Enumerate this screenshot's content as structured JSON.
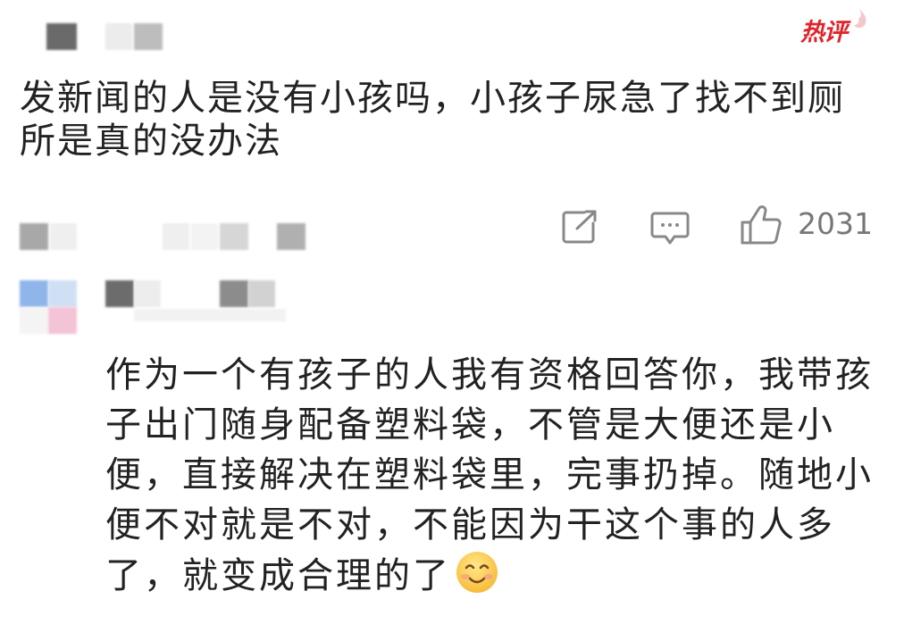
{
  "badges": {
    "hot": "热评"
  },
  "comment": {
    "text": "发新闻的人是没有小孩吗，小孩子尿急了找不到厕所是真的没办法",
    "like_count": "2031"
  },
  "reply": {
    "text": "作为一个有孩子的人我有资格回答你，我带孩子出门随身配备塑料袋，不管是大便还是小便，直接解决在塑料袋里，完事扔掉。随地小便不对就是不对，不能因为干这个事的人多了，就变成合理的了"
  },
  "icons": {
    "hot": "flame-icon",
    "share": "share-icon",
    "comment": "comment-icon",
    "like": "thumbs-up-icon",
    "emoji": "smiling-face-icon"
  },
  "colors": {
    "hot_badge": "#e0242b",
    "icon_gray": "#888888",
    "text": "#222222"
  }
}
